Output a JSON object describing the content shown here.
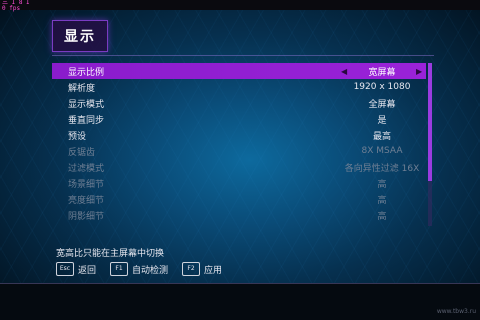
{
  "overlay": {
    "text": "三 I 8 I\n0 fps"
  },
  "page": {
    "title": "显示"
  },
  "settings": [
    {
      "label": "显示比例",
      "value": "宽屏幕",
      "selected": true,
      "disabled": false
    },
    {
      "label": "解析度",
      "value": "1920 x 1080",
      "selected": false,
      "disabled": false
    },
    {
      "label": "显示模式",
      "value": "全屏幕",
      "selected": false,
      "disabled": false
    },
    {
      "label": "垂直同步",
      "value": "是",
      "selected": false,
      "disabled": false
    },
    {
      "label": "预设",
      "value": "最高",
      "selected": false,
      "disabled": false
    },
    {
      "label": "反锯齿",
      "value": "8X MSAA",
      "selected": false,
      "disabled": true
    },
    {
      "label": "过滤模式",
      "value": "各向异性过滤 16X",
      "selected": false,
      "disabled": true
    },
    {
      "label": "场景细节",
      "value": "高",
      "selected": false,
      "disabled": true
    },
    {
      "label": "亮度细节",
      "value": "高",
      "selected": false,
      "disabled": true
    },
    {
      "label": "阴影细节",
      "value": "高",
      "selected": false,
      "disabled": true
    }
  ],
  "hint": "宽高比只能在主屏幕中切换",
  "footer": {
    "back": {
      "key": "Esc",
      "label": "返回"
    },
    "auto_detect": {
      "key": "F1",
      "label": "自动检测"
    },
    "apply": {
      "key": "F2",
      "label": "应用"
    }
  },
  "watermark": "www.tbw3.ru",
  "colors": {
    "accent": "#9a22d8",
    "background": "#0a4c78"
  },
  "icons": {
    "arrow_left": "left-arrow-icon",
    "arrow_right": "right-arrow-icon"
  }
}
